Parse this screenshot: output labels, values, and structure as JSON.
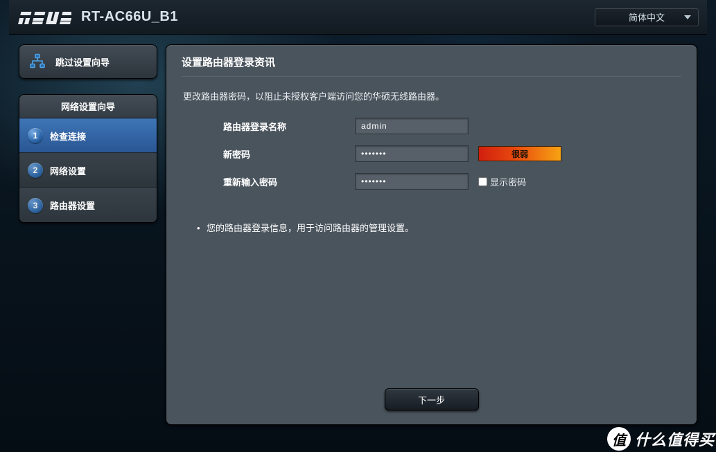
{
  "header": {
    "brand": "ASUS",
    "model": "RT-AC66U_B1",
    "language": "简体中文"
  },
  "sidebar": {
    "skip_wizard": "跳过设置向导",
    "wizard_title": "网络设置向导",
    "steps": [
      {
        "num": "1",
        "label": "检查连接",
        "active": true
      },
      {
        "num": "2",
        "label": "网络设置",
        "active": false
      },
      {
        "num": "3",
        "label": "路由器设置",
        "active": false
      }
    ]
  },
  "panel": {
    "title": "设置路由器登录资讯",
    "description": "更改路由器密码，以阻止未授权客户端访问您的华硕无线路由器。",
    "login_name_label": "路由器登录名称",
    "login_name_value": "admin",
    "new_password_label": "新密码",
    "new_password_value": "•••••••",
    "strength_text": "很弱",
    "confirm_password_label": "重新输入密码",
    "confirm_password_value": "•••••••",
    "show_password_label": "显示密码",
    "note": "您的路由器登录信息，用于访问路由器的管理设置。",
    "next_button": "下一步"
  },
  "watermark": {
    "badge_char": "值",
    "text": "什么值得买"
  }
}
